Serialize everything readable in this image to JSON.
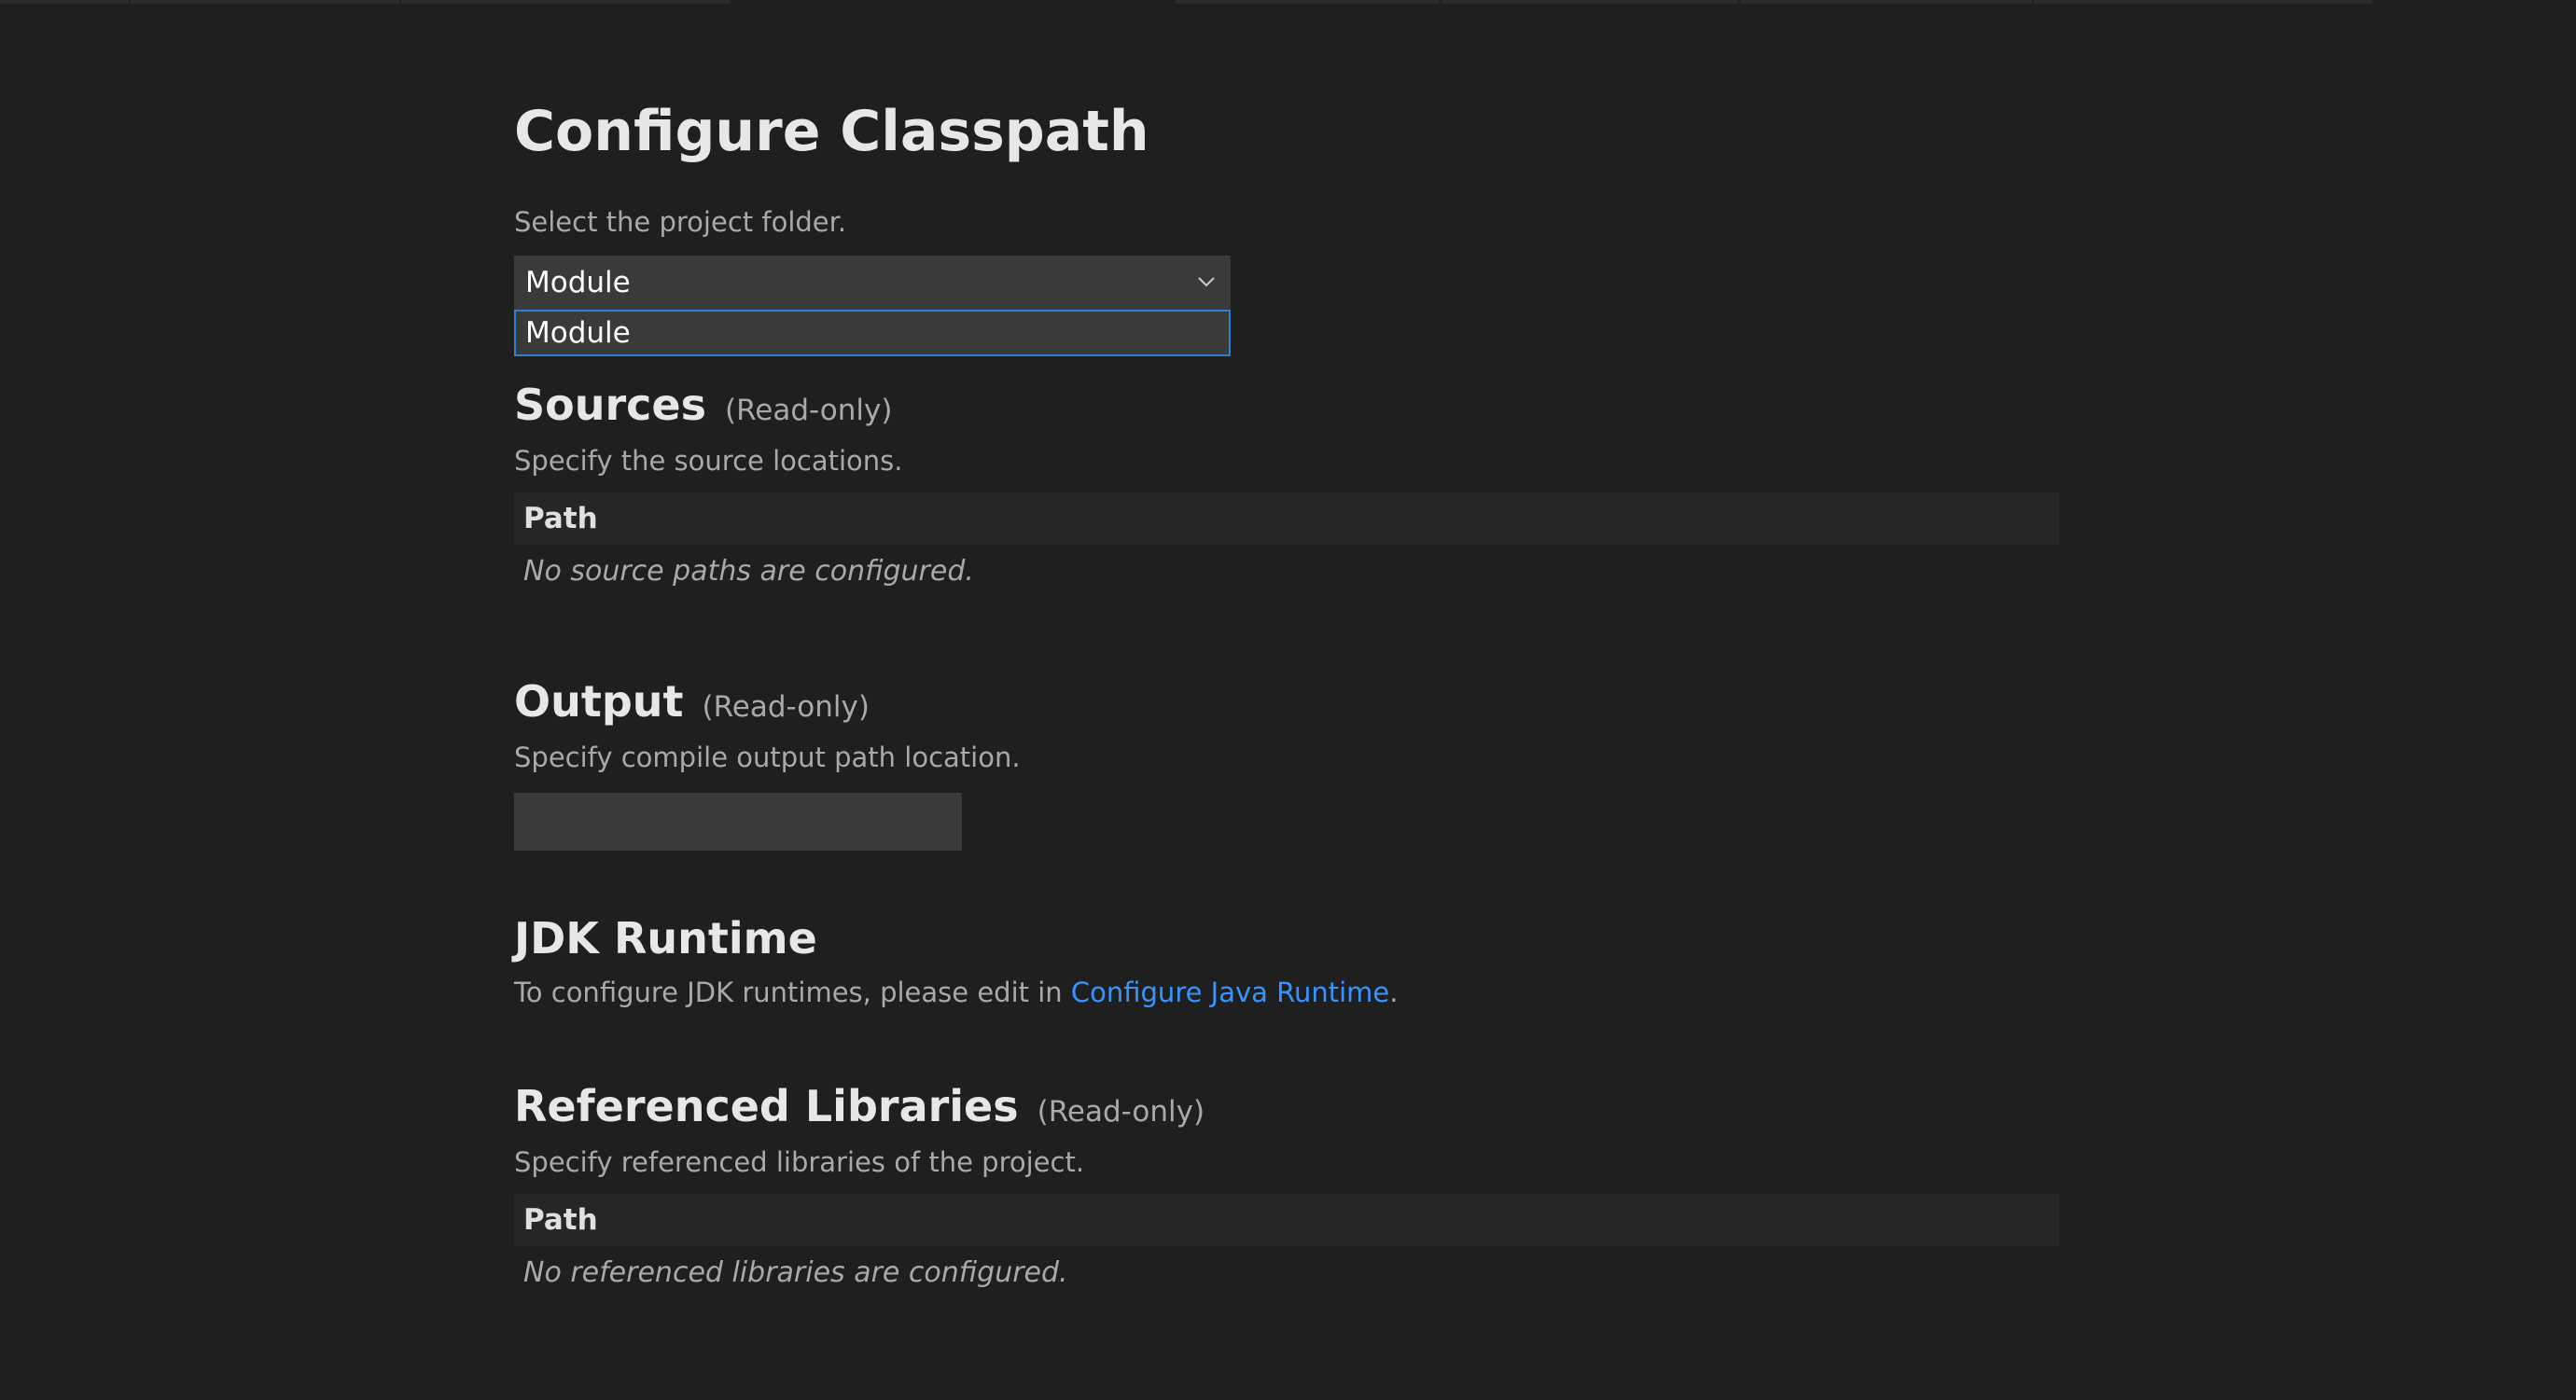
{
  "page": {
    "title": "Configure Classpath"
  },
  "project": {
    "prompt": "Select the project folder.",
    "selected": "Module",
    "options": [
      "Module"
    ]
  },
  "sources": {
    "title": "Sources",
    "readonly": "(Read-only)",
    "description": "Specify the source locations.",
    "column": "Path",
    "empty": "No source paths are configured."
  },
  "output": {
    "title": "Output",
    "readonly": "(Read-only)",
    "description": "Specify compile output path location.",
    "value": ""
  },
  "jdk": {
    "title": "JDK Runtime",
    "text_before": "To configure JDK runtimes, please edit in ",
    "link": "Configure Java Runtime",
    "text_after": "."
  },
  "libraries": {
    "title": "Referenced Libraries",
    "readonly": "(Read-only)",
    "description": "Specify referenced libraries of the project.",
    "column": "Path",
    "empty": "No referenced libraries are configured."
  },
  "colors": {
    "background": "#1f1f1f",
    "input": "#3a3a3a",
    "focus_border": "#2f7fd6",
    "link": "#3794ff"
  },
  "icons": {
    "dropdown": "chevron-down-icon"
  }
}
